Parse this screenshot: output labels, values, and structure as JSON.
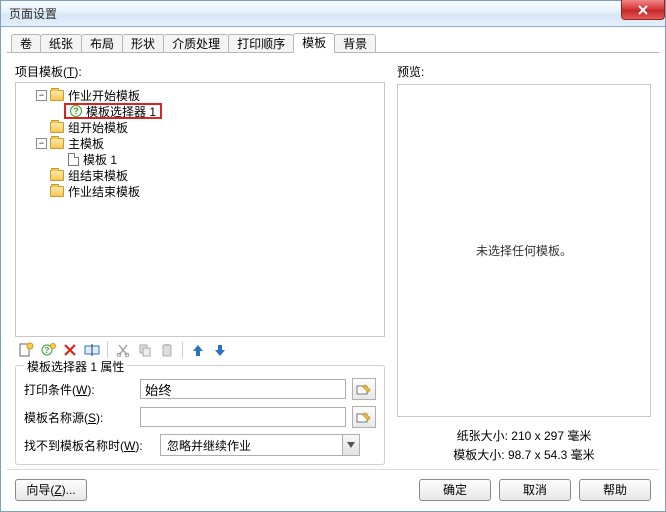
{
  "window": {
    "title": "页面设置"
  },
  "tabs": {
    "items": [
      {
        "label": "卷"
      },
      {
        "label": "纸张"
      },
      {
        "label": "布局"
      },
      {
        "label": "形状"
      },
      {
        "label": "介质处理"
      },
      {
        "label": "打印顺序"
      },
      {
        "label": "模板"
      },
      {
        "label": "背景"
      }
    ],
    "active_index": 6
  },
  "left": {
    "tree_label": "项目模板(T):",
    "nodes": {
      "job_start": "作业开始模板",
      "selector_1": "模板选择器 1",
      "group_start": "组开始模板",
      "main": "主模板",
      "template_1": "模板 1",
      "group_end": "组结束模板",
      "job_end": "作业结束模板"
    },
    "minus": "−",
    "props": {
      "legend": "模板选择器 1 属性",
      "print_cond_label": "打印条件(W):",
      "print_cond_value": "始终",
      "tmpl_src_label": "模板名称源(S):",
      "tmpl_src_value": "",
      "notfound_label": "找不到模板名称时(W):",
      "notfound_value": "忽略并继续作业"
    }
  },
  "right": {
    "preview_label": "预览:",
    "preview_empty": "未选择任何模板。",
    "paper_size": "纸张大小:  210 x 297 毫米",
    "template_size": "模板大小:  98.7 x 54.3 毫米"
  },
  "footer": {
    "wizard": "向导(Z)...",
    "ok": "确定",
    "cancel": "取消",
    "help": "帮助"
  }
}
